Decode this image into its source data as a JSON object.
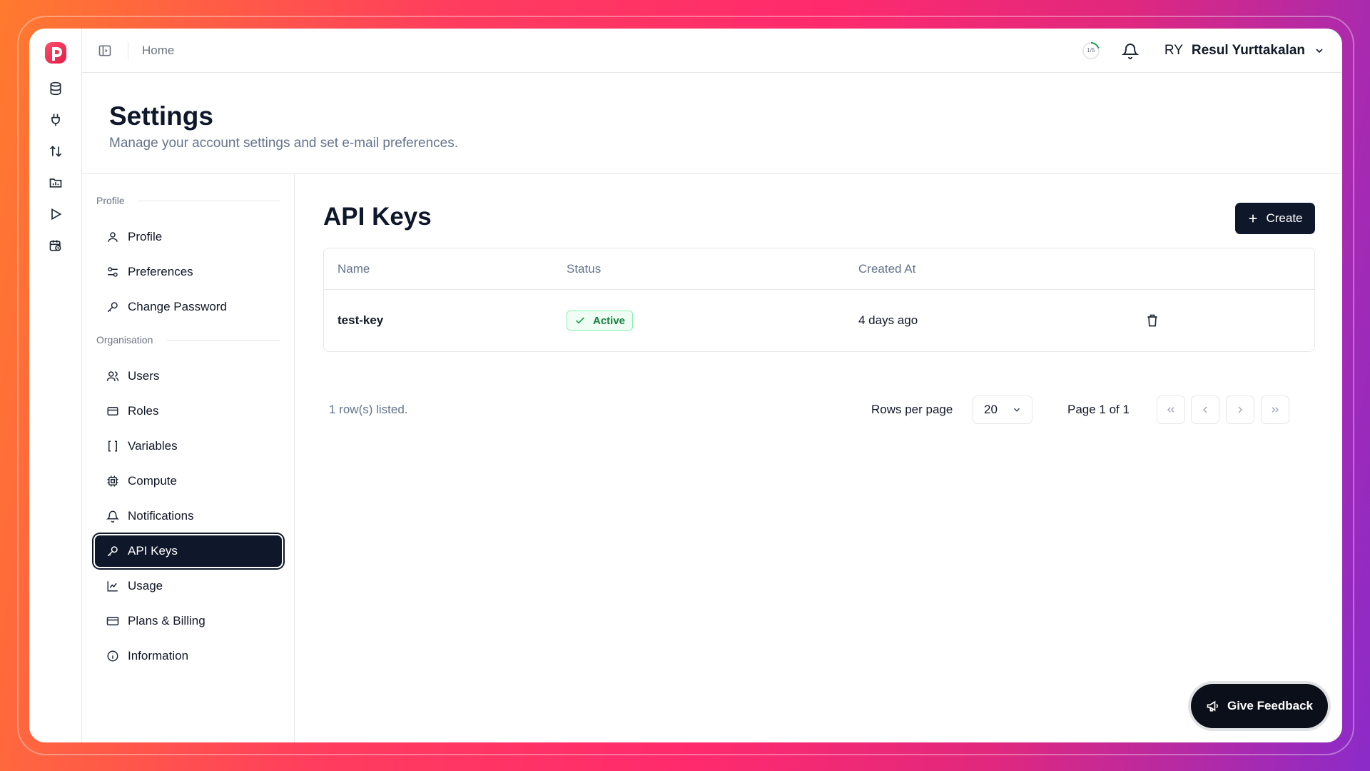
{
  "topbar": {
    "breadcrumb": "Home",
    "progress_label": "1/5",
    "user_initials": "RY",
    "user_name": "Resul Yurttakalan"
  },
  "page": {
    "title": "Settings",
    "subtitle": "Manage your account settings and set e-mail preferences."
  },
  "sidebar": {
    "groups": [
      {
        "label": "Profile"
      },
      {
        "label": "Organisation"
      }
    ],
    "items": [
      {
        "label": "Profile",
        "icon": "user-icon"
      },
      {
        "label": "Preferences",
        "icon": "sliders-icon"
      },
      {
        "label": "Change Password",
        "icon": "key-icon"
      },
      {
        "label": "Users",
        "icon": "users-icon"
      },
      {
        "label": "Roles",
        "icon": "card-icon"
      },
      {
        "label": "Variables",
        "icon": "brackets-icon"
      },
      {
        "label": "Compute",
        "icon": "cpu-icon"
      },
      {
        "label": "Notifications",
        "icon": "bell-icon"
      },
      {
        "label": "API Keys",
        "icon": "key-icon",
        "active": true
      },
      {
        "label": "Usage",
        "icon": "chart-line-icon"
      },
      {
        "label": "Plans & Billing",
        "icon": "credit-card-icon"
      },
      {
        "label": "Information",
        "icon": "info-icon"
      }
    ]
  },
  "main": {
    "title": "API Keys",
    "create_label": "Create",
    "table": {
      "headers": [
        "Name",
        "Status",
        "Created At"
      ],
      "rows": [
        {
          "name": "test-key",
          "status": "Active",
          "created_at": "4 days ago"
        }
      ]
    },
    "footer": {
      "rows_listed": "1 row(s) listed.",
      "rows_per_page_label": "Rows per page",
      "rows_per_page_value": "20",
      "page_info": "Page 1 of 1"
    }
  },
  "feedback_label": "Give Feedback",
  "colors": {
    "primary": "#0f172a",
    "brand": "#e11d48",
    "success": "#16a34a"
  }
}
